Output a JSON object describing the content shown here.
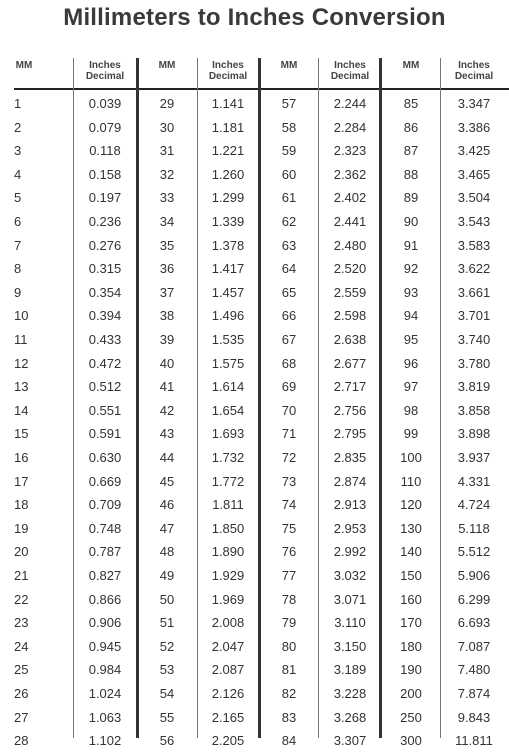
{
  "title": "Millimeters to Inches Conversion",
  "headers": {
    "mm": "MM",
    "inches_line1": "Inches",
    "inches_line2": "Decimal"
  },
  "groups": [
    {
      "rows": [
        [
          "1",
          "0.039"
        ],
        [
          "2",
          "0.079"
        ],
        [
          "3",
          "0.118"
        ],
        [
          "4",
          "0.158"
        ],
        [
          "5",
          "0.197"
        ],
        [
          "6",
          "0.236"
        ],
        [
          "7",
          "0.276"
        ],
        [
          "8",
          "0.315"
        ],
        [
          "9",
          "0.354"
        ],
        [
          "10",
          "0.394"
        ],
        [
          "11",
          "0.433"
        ],
        [
          "12",
          "0.472"
        ],
        [
          "13",
          "0.512"
        ],
        [
          "14",
          "0.551"
        ],
        [
          "15",
          "0.591"
        ],
        [
          "16",
          "0.630"
        ],
        [
          "17",
          "0.669"
        ],
        [
          "18",
          "0.709"
        ],
        [
          "19",
          "0.748"
        ],
        [
          "20",
          "0.787"
        ],
        [
          "21",
          "0.827"
        ],
        [
          "22",
          "0.866"
        ],
        [
          "23",
          "0.906"
        ],
        [
          "24",
          "0.945"
        ],
        [
          "25",
          "0.984"
        ],
        [
          "26",
          "1.024"
        ],
        [
          "27",
          "1.063"
        ],
        [
          "28",
          "1.102"
        ]
      ]
    },
    {
      "rows": [
        [
          "29",
          "1.141"
        ],
        [
          "30",
          "1.181"
        ],
        [
          "31",
          "1.221"
        ],
        [
          "32",
          "1.260"
        ],
        [
          "33",
          "1.299"
        ],
        [
          "34",
          "1.339"
        ],
        [
          "35",
          "1.378"
        ],
        [
          "36",
          "1.417"
        ],
        [
          "37",
          "1.457"
        ],
        [
          "38",
          "1.496"
        ],
        [
          "39",
          "1.535"
        ],
        [
          "40",
          "1.575"
        ],
        [
          "41",
          "1.614"
        ],
        [
          "42",
          "1.654"
        ],
        [
          "43",
          "1.693"
        ],
        [
          "44",
          "1.732"
        ],
        [
          "45",
          "1.772"
        ],
        [
          "46",
          "1.811"
        ],
        [
          "47",
          "1.850"
        ],
        [
          "48",
          "1.890"
        ],
        [
          "49",
          "1.929"
        ],
        [
          "50",
          "1.969"
        ],
        [
          "51",
          "2.008"
        ],
        [
          "52",
          "2.047"
        ],
        [
          "53",
          "2.087"
        ],
        [
          "54",
          "2.126"
        ],
        [
          "55",
          "2.165"
        ],
        [
          "56",
          "2.205"
        ]
      ]
    },
    {
      "rows": [
        [
          "57",
          "2.244"
        ],
        [
          "58",
          "2.284"
        ],
        [
          "59",
          "2.323"
        ],
        [
          "60",
          "2.362"
        ],
        [
          "61",
          "2.402"
        ],
        [
          "62",
          "2.441"
        ],
        [
          "63",
          "2.480"
        ],
        [
          "64",
          "2.520"
        ],
        [
          "65",
          "2.559"
        ],
        [
          "66",
          "2.598"
        ],
        [
          "67",
          "2.638"
        ],
        [
          "68",
          "2.677"
        ],
        [
          "69",
          "2.717"
        ],
        [
          "70",
          "2.756"
        ],
        [
          "71",
          "2.795"
        ],
        [
          "72",
          "2.835"
        ],
        [
          "73",
          "2.874"
        ],
        [
          "74",
          "2.913"
        ],
        [
          "75",
          "2.953"
        ],
        [
          "76",
          "2.992"
        ],
        [
          "77",
          "3.032"
        ],
        [
          "78",
          "3.071"
        ],
        [
          "79",
          "3.110"
        ],
        [
          "80",
          "3.150"
        ],
        [
          "81",
          "3.189"
        ],
        [
          "82",
          "3.228"
        ],
        [
          "83",
          "3.268"
        ],
        [
          "84",
          "3.307"
        ]
      ]
    },
    {
      "rows": [
        [
          "85",
          "3.347"
        ],
        [
          "86",
          "3.386"
        ],
        [
          "87",
          "3.425"
        ],
        [
          "88",
          "3.465"
        ],
        [
          "89",
          "3.504"
        ],
        [
          "90",
          "3.543"
        ],
        [
          "91",
          "3.583"
        ],
        [
          "92",
          "3.622"
        ],
        [
          "93",
          "3.661"
        ],
        [
          "94",
          "3.701"
        ],
        [
          "95",
          "3.740"
        ],
        [
          "96",
          "3.780"
        ],
        [
          "97",
          "3.819"
        ],
        [
          "98",
          "3.858"
        ],
        [
          "99",
          "3.898"
        ],
        [
          "100",
          "3.937"
        ],
        [
          "110",
          "4.331"
        ],
        [
          "120",
          "4.724"
        ],
        [
          "130",
          "5.118"
        ],
        [
          "140",
          "5.512"
        ],
        [
          "150",
          "5.906"
        ],
        [
          "160",
          "6.299"
        ],
        [
          "170",
          "6.693"
        ],
        [
          "180",
          "7.087"
        ],
        [
          "190",
          "7.480"
        ],
        [
          "200",
          "7.874"
        ],
        [
          "250",
          "9.843"
        ],
        [
          "300",
          "11.811"
        ]
      ]
    }
  ]
}
